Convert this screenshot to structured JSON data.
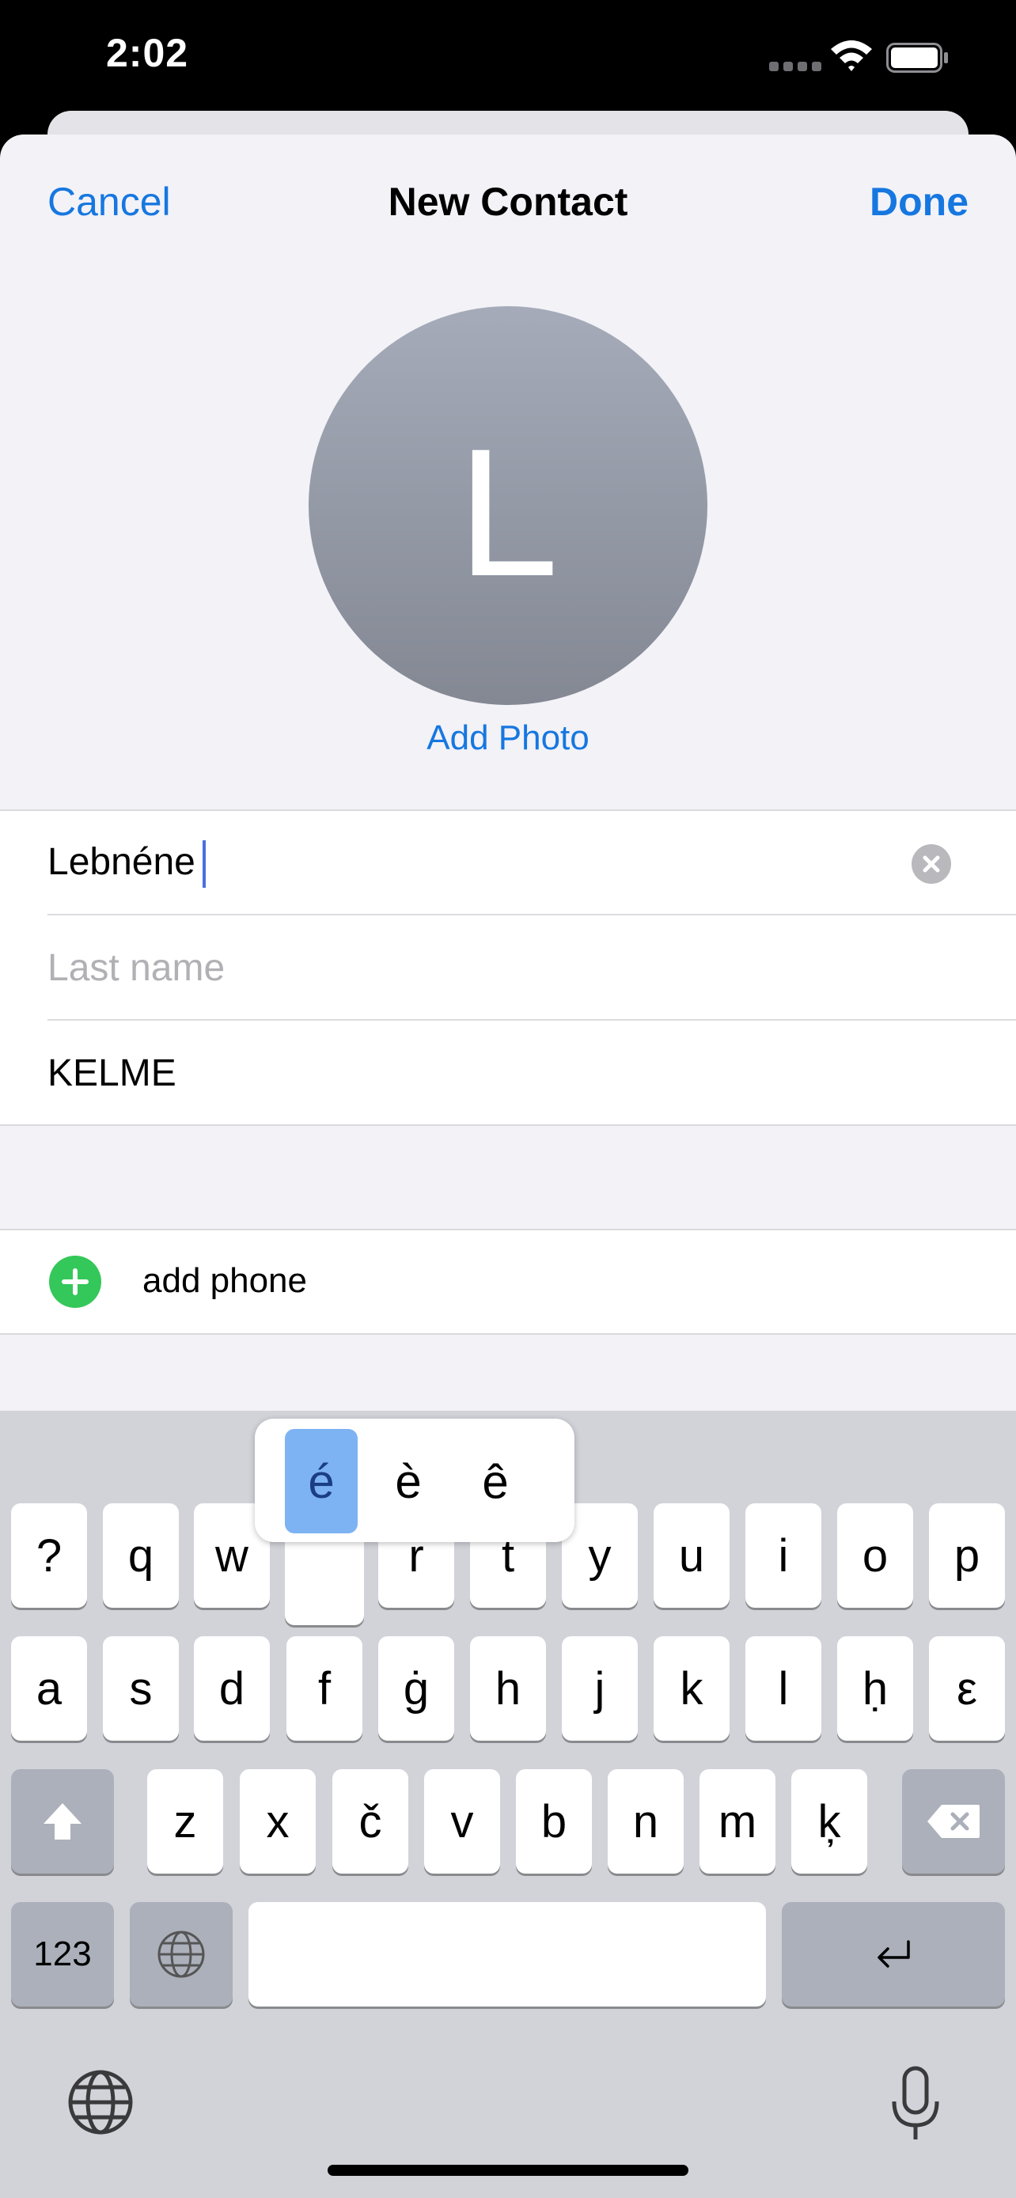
{
  "status_bar": {
    "time": "2:02"
  },
  "header": {
    "cancel_label": "Cancel",
    "title": "New Contact",
    "done_label": "Done"
  },
  "avatar": {
    "initial": "L",
    "add_photo_label": "Add Photo"
  },
  "form": {
    "first_name_value": "Lebnéne",
    "last_name_placeholder": "Last name",
    "company_value": "KELME"
  },
  "phone": {
    "add_phone_label": "add phone"
  },
  "keyboard": {
    "accent_options": [
      "é",
      "è",
      "ê"
    ],
    "row1": [
      "?",
      "q",
      "w",
      "e",
      "r",
      "t",
      "y",
      "u",
      "i",
      "o",
      "p"
    ],
    "row2": [
      "a",
      "s",
      "d",
      "f",
      "ġ",
      "h",
      "j",
      "k",
      "l",
      "ḥ",
      "ε"
    ],
    "row3": [
      "z",
      "x",
      "č",
      "v",
      "b",
      "n",
      "m",
      "ķ"
    ],
    "numbers_label": "123"
  },
  "colors": {
    "accent": "#1677e0",
    "add_green": "#34c759",
    "keyboard_bg": "#d1d3d9"
  }
}
